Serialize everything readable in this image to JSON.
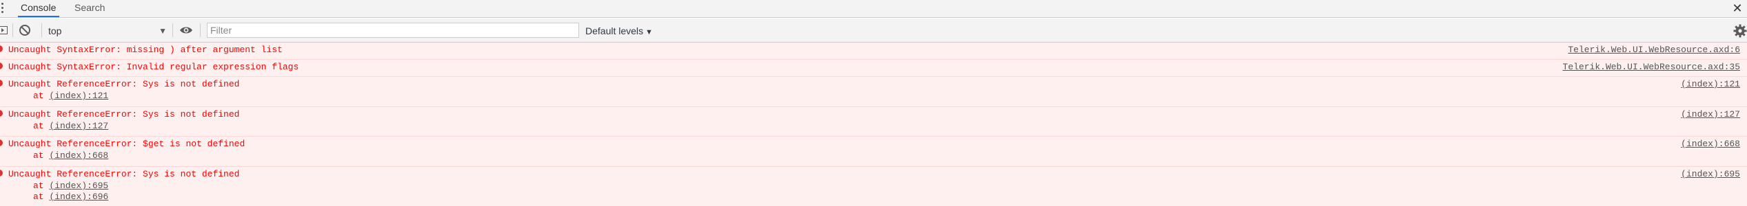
{
  "tabs": [
    {
      "label": "Console"
    },
    {
      "label": "Search"
    }
  ],
  "toolbar": {
    "context": "top",
    "filter_placeholder": "Filter",
    "levels": "Default levels"
  },
  "icons": {
    "menu": "more-vertical-icon",
    "close": "close-icon",
    "sidebar": "sidebar-toggle-icon",
    "clear": "clear-console-icon",
    "eye": "eye-icon",
    "settings": "gear-icon",
    "error": "error-icon"
  },
  "colors": {
    "error_text": "#ff0000",
    "error_bg": "#fff0f0",
    "error_border": "#ffd6d6",
    "tab_accent": "#1a73e8",
    "link": "#545454"
  },
  "messages": [
    {
      "text": "Uncaught SyntaxError: missing ) after argument list",
      "source": "Telerik.Web.UI.WebResource.axd:6",
      "stack": []
    },
    {
      "text": "Uncaught SyntaxError: Invalid regular expression flags",
      "source": "Telerik.Web.UI.WebResource.axd:35",
      "stack": []
    },
    {
      "text": "Uncaught ReferenceError: Sys is not defined",
      "source": "(index):121",
      "stack": [
        {
          "prefix": "at ",
          "link": "(index):121"
        }
      ]
    },
    {
      "text": "Uncaught ReferenceError: Sys is not defined",
      "source": "(index):127",
      "stack": [
        {
          "prefix": "at ",
          "link": "(index):127"
        }
      ]
    },
    {
      "text": "Uncaught ReferenceError: $get is not defined",
      "source": "(index):668",
      "stack": [
        {
          "prefix": "at ",
          "link": "(index):668"
        }
      ]
    },
    {
      "text": "Uncaught ReferenceError: Sys is not defined",
      "source": "(index):695",
      "stack": [
        {
          "prefix": "at ",
          "link": "(index):695"
        },
        {
          "prefix": "at ",
          "link": "(index):696"
        }
      ]
    }
  ]
}
